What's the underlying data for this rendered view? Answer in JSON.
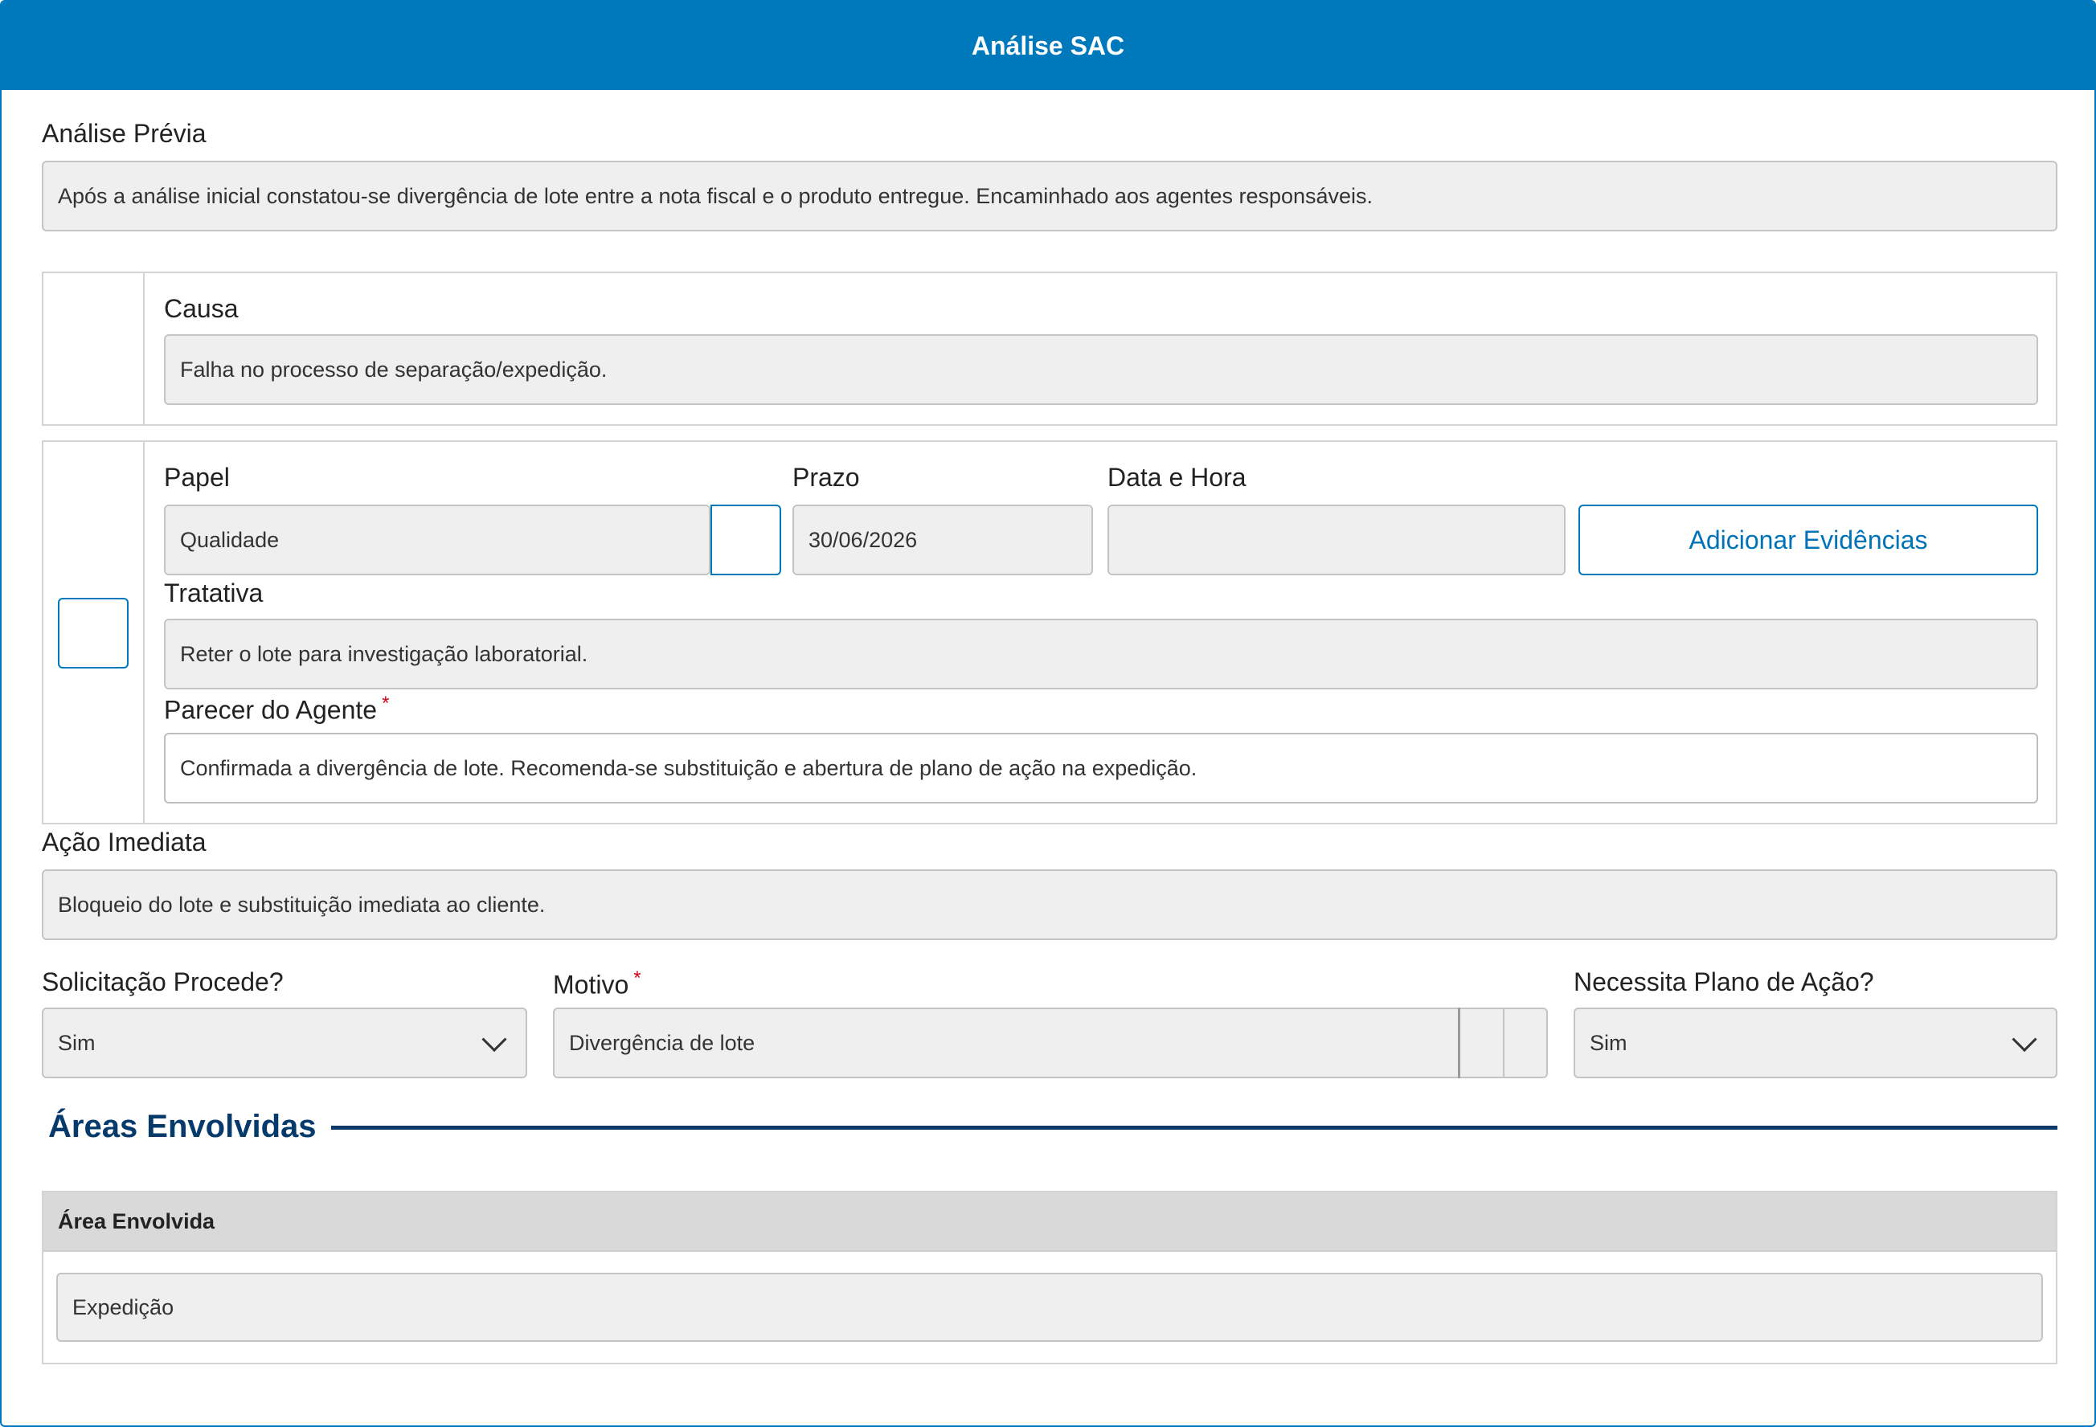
{
  "window": {
    "title": "Análise SAC"
  },
  "analise_previa": {
    "label": "Análise Prévia",
    "value": "Após a análise inicial constatou-se divergência de lote entre a nota fiscal e o produto entregue. Encaminhado aos agentes responsáveis."
  },
  "causa": {
    "label": "Causa",
    "value": "Falha no processo de separação/expedição."
  },
  "agente": {
    "papel_label": "Papel",
    "papel_value": "Qualidade",
    "prazo_label": "Prazo",
    "prazo_value": "30/06/2026",
    "data_hora_label": "Data e Hora",
    "data_hora_value": "",
    "evidencias_button": "Adicionar Evidências",
    "tratativa_label": "Tratativa",
    "tratativa_value": "Reter o lote para investigação laboratorial.",
    "parecer_label": "Parecer do Agente",
    "parecer_required": "*",
    "parecer_value": "Confirmada a divergência de lote. Recomenda-se substituição e abertura de plano de ação na expedição."
  },
  "acao_imediata": {
    "label": "Ação Imediata",
    "value": "Bloqueio do lote e substituição imediata ao cliente."
  },
  "solicitacao": {
    "label": "Solicitação Procede?",
    "value": "Sim"
  },
  "motivo": {
    "label": "Motivo",
    "required": "*",
    "value": "Divergência de lote"
  },
  "plano_acao": {
    "label": "Necessita Plano de Ação?",
    "value": "Sim"
  },
  "areas": {
    "title": "Áreas Envolvidas",
    "column_header": "Área Envolvida",
    "rows": [
      "Expedição"
    ]
  },
  "colors": {
    "header_bg": "#0079bc",
    "accent": "#0073b8",
    "section_title": "#053a6b",
    "required": "#d0021b"
  }
}
